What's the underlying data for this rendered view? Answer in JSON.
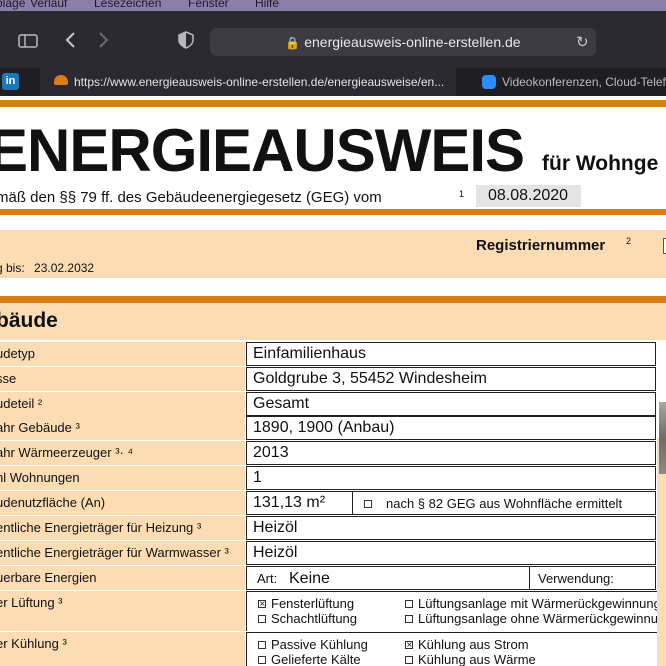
{
  "menubar": {
    "items": [
      "Ablage",
      "Verlauf",
      "Lesezeichen",
      "Fenster",
      "Hilfe"
    ]
  },
  "browser": {
    "address": "energieausweis-online-erstellen.de",
    "icons": [
      "sidebar-icon",
      "back-icon",
      "forward-icon",
      "shield-icon",
      "lock-icon",
      "reload-icon"
    ],
    "tabs": [
      {
        "label": "https://www.energieausweis-online-erstellen.de/energieausweise/en...",
        "active": true
      },
      {
        "label": "Videokonferenzen, Cloud-Telefo",
        "active": false
      }
    ]
  },
  "document": {
    "title": "ENERGIEAUSWEIS",
    "subtitle": "für Wohnge",
    "law_text": "mäß den §§ 79 ff. des Gebäudeenergiegesetz (GEG) vom",
    "law_sup": "1",
    "date": "08.08.2020",
    "reg_label": "Registriernummer",
    "reg_sup": "2",
    "valid_label": "g bis:",
    "valid_date": "23.02.2032",
    "section_title": "bäude",
    "rows": [
      {
        "label": "udetyp",
        "value": "Einfamilienhaus"
      },
      {
        "label": "sse",
        "value": "Goldgrube 3, 55452 Windesheim"
      },
      {
        "label": "udeteil ²",
        "value": "Gesamt"
      },
      {
        "label": "ahr Gebäude ³",
        "value": "1890, 1900 (Anbau)"
      },
      {
        "label": "ahr Wärmeerzeuger ³· ⁴",
        "value": "2013"
      },
      {
        "label": "hl Wohnungen",
        "value": "1"
      },
      {
        "label": "udenutzfläche (An)",
        "value": "131,13 m²"
      },
      {
        "label": "entliche Energieträger für Heizung ³",
        "value": "Heizöl"
      },
      {
        "label": "entliche Energieträger für Warmwasser ³",
        "value": "Heizöl"
      },
      {
        "label": "uerbare Energien"
      },
      {
        "label": "er Lüftung ³"
      },
      {
        "label": "er Kühlung ³"
      }
    ],
    "area_note": "nach § 82 GEG aus Wohnfläche ermittelt",
    "renewable": {
      "art_label": "Art:",
      "art_value": "Keine",
      "use_label": "Verwendung:"
    },
    "ventilation": [
      {
        "label": "Fensterlüftung",
        "checked": true
      },
      {
        "label": "Lüftungsanlage mit Wärmerückgewinnung",
        "checked": false
      },
      {
        "label": "Schachtlüftung",
        "checked": false
      },
      {
        "label": "Lüftungsanlage ohne Wärmerückgewinnu",
        "checked": false
      }
    ],
    "cooling": [
      {
        "label": "Passive Kühlung",
        "checked": false
      },
      {
        "label": "Kühlung aus Strom",
        "checked": true
      },
      {
        "label": "Gelieferte Kälte",
        "checked": false
      },
      {
        "label": "Kühlung aus Wärme",
        "checked": false
      }
    ],
    "check_mark": "×",
    "colors": {
      "accent": "#d97e14",
      "label_bg": "#fbdcb3"
    }
  }
}
